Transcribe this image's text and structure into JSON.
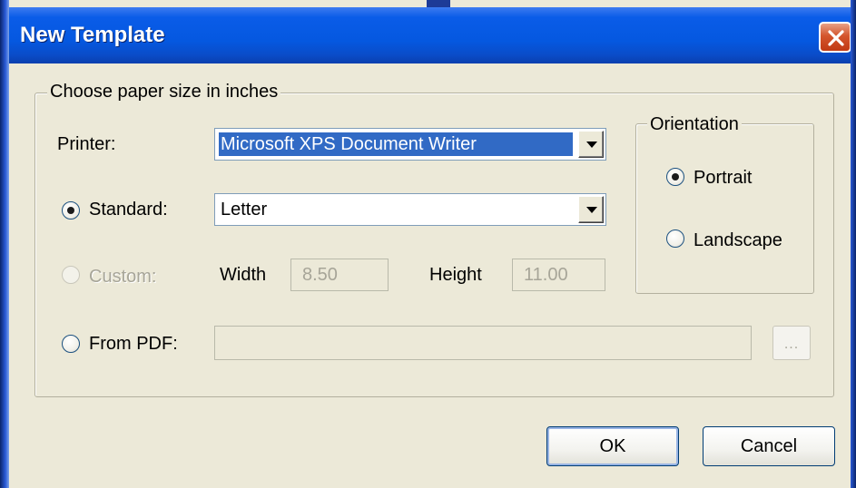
{
  "window": {
    "title": "New Template"
  },
  "paper_group": {
    "legend": "Choose paper size in inches"
  },
  "printer": {
    "label": "Printer:",
    "selected": "Microsoft XPS Document Writer"
  },
  "standard": {
    "label": "Standard:",
    "selected": "Letter",
    "checked": true
  },
  "custom": {
    "label": "Custom:",
    "checked": false,
    "width_label": "Width",
    "width_value": "8.50",
    "height_label": "Height",
    "height_value": "11.00"
  },
  "from_pdf": {
    "label": "From PDF:",
    "value": "",
    "browse_label": "..."
  },
  "orientation": {
    "legend": "Orientation",
    "options": [
      {
        "label": "Portrait",
        "checked": true
      },
      {
        "label": "Landscape",
        "checked": false
      }
    ]
  },
  "buttons": {
    "ok": "OK",
    "cancel": "Cancel"
  }
}
